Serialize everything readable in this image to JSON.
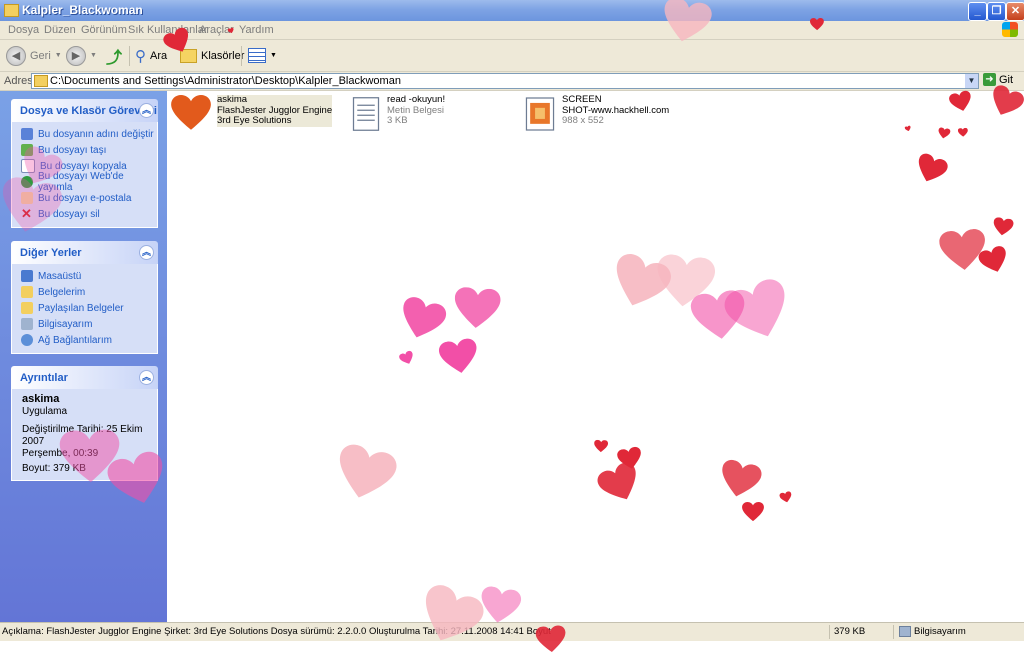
{
  "window": {
    "title": "Kalpler_Blackwoman"
  },
  "menu": [
    "Dosya",
    "Düzen",
    "Görünüm",
    "Sık Kullanılanlar",
    "Araçlar",
    "Yardım"
  ],
  "toolbar": {
    "back_label": "Geri",
    "search_label": "Ara",
    "folders_label": "Klasörler"
  },
  "address": {
    "label": "Adres",
    "path": "C:\\Documents and Settings\\Administrator\\Desktop\\Kalpler_Blackwoman",
    "go_label": "Git"
  },
  "tasks": {
    "title": "Dosya ve Klasör Görevleri",
    "items": [
      {
        "label": "Bu dosyanın adını değiştir",
        "icon": "rename-icon"
      },
      {
        "label": "Bu dosyayı taşı",
        "icon": "move-icon"
      },
      {
        "label": "Bu dosyayı kopyala",
        "icon": "copy-icon"
      },
      {
        "label": "Bu dosyayı Web'de yayımla",
        "icon": "web-publish-icon"
      },
      {
        "label": "Bu dosyayı e-postala",
        "icon": "email-icon"
      },
      {
        "label": "Bu dosyayı sil",
        "icon": "delete-icon"
      }
    ]
  },
  "places": {
    "title": "Diğer Yerler",
    "items": [
      {
        "label": "Masaüstü",
        "icon": "desktop-icon"
      },
      {
        "label": "Belgelerim",
        "icon": "my-documents-icon"
      },
      {
        "label": "Paylaşılan Belgeler",
        "icon": "shared-documents-icon"
      },
      {
        "label": "Bilgisayarım",
        "icon": "my-computer-icon"
      },
      {
        "label": "Ağ Bağlantılarım",
        "icon": "network-icon"
      }
    ]
  },
  "details": {
    "title": "Ayrıntılar",
    "name": "askima",
    "type": "Uygulama",
    "modified_line1": "Değiştirilme Tarihi: 25 Ekim 2007",
    "modified_line2": "Perşembe, 00:39",
    "size": "Boyut: 379 KB"
  },
  "files": [
    {
      "name": "askima",
      "line2": "FlashJester Jugglor Engine",
      "line3": "3rd Eye Solutions",
      "icon": "heart-app-icon",
      "selected": true
    },
    {
      "name": "read -okuyun!",
      "line2": "Metin Belgesi",
      "line3": "3 KB",
      "icon": "text-document-icon"
    },
    {
      "name": "SCREEN",
      "line2": "SHOT-www.hackhell.com",
      "line3": "988 x 552",
      "icon": "image-file-icon"
    }
  ],
  "status": {
    "description": "Açıklama: FlashJester Jugglor Engine Şirket: 3rd Eye Solutions Dosya sürümü: 2.2.0.0 Oluşturulma Tarihi: 27.11.2008 14:41 Boyut",
    "size": "379 KB",
    "zone": "Bilgisayarım"
  },
  "colors": {
    "heart_red": "#e02838",
    "heart_pink": "#f24fa7",
    "heart_light": "#f7b7c0",
    "xp_blue": "#215dc6"
  }
}
